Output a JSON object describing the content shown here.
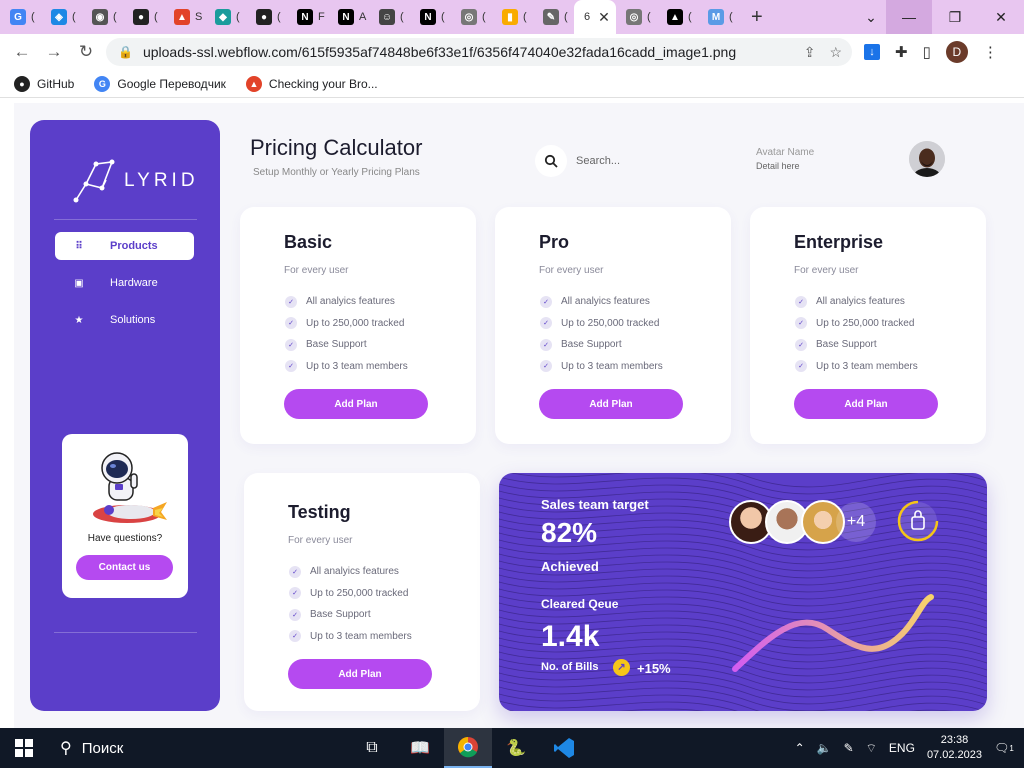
{
  "browser": {
    "tabs": [
      {
        "icon": "google-translate-icon",
        "color": "#4285f4",
        "glyph": "G",
        "label": "("
      },
      {
        "icon": "vscode-blue-icon",
        "color": "#1e88e5",
        "glyph": "◈",
        "label": "("
      },
      {
        "icon": "browser-icon",
        "color": "#555555",
        "glyph": "◉",
        "label": "("
      },
      {
        "icon": "github-icon",
        "color": "#222222",
        "glyph": "●",
        "label": "("
      },
      {
        "icon": "gitlab-icon",
        "color": "#e24329",
        "glyph": "▲",
        "label": "S"
      },
      {
        "icon": "diamond-icon",
        "color": "#1a9c9c",
        "glyph": "◆",
        "label": "("
      },
      {
        "icon": "github-icon",
        "color": "#222222",
        "glyph": "●",
        "label": "("
      },
      {
        "icon": "nextjs-icon",
        "color": "#000000",
        "glyph": "N",
        "label": "F"
      },
      {
        "icon": "nextjs-icon",
        "color": "#000000",
        "glyph": "N",
        "label": "A"
      },
      {
        "icon": "face-icon",
        "color": "#444444",
        "glyph": "☺",
        "label": "("
      },
      {
        "icon": "nextjs-icon",
        "color": "#000000",
        "glyph": "N",
        "label": "("
      },
      {
        "icon": "chrome-icon",
        "color": "#777777",
        "glyph": "◎",
        "label": "("
      },
      {
        "icon": "analytics-icon",
        "color": "#f9ab00",
        "glyph": "▮",
        "label": "("
      },
      {
        "icon": "pen-icon",
        "color": "#666666",
        "glyph": "✎",
        "label": "("
      }
    ],
    "active_tab": {
      "label": "6",
      "close": "✕"
    },
    "tabs_after": [
      {
        "icon": "chrome-icon",
        "color": "#777777",
        "glyph": "◎",
        "label": "("
      },
      {
        "icon": "vercel-icon",
        "color": "#000000",
        "glyph": "▲",
        "label": "("
      },
      {
        "icon": "vs-icon",
        "color": "#5a9be6",
        "glyph": "M",
        "label": "("
      }
    ],
    "new_tab": "+",
    "url": "uploads-ssl.webflow.com/615f5935af74848be6f33e1f/6356f474040e32fada16cadd_image1.png",
    "profile_initial": "D",
    "bookmarks": [
      {
        "label": "GitHub",
        "icon": "github-icon",
        "color": "#222222",
        "glyph": "●"
      },
      {
        "label": "Google Переводчик",
        "icon": "google-translate-icon",
        "color": "#4285f4",
        "glyph": "G"
      },
      {
        "label": "Checking your Bro...",
        "icon": "gitlab-icon",
        "color": "#e24329",
        "glyph": "▲"
      }
    ]
  },
  "sidebar": {
    "logo_text": "LYRID",
    "items": [
      {
        "label": "Products",
        "icon": "grid-icon",
        "glyph": "⠿",
        "active": true
      },
      {
        "label": "Hardware",
        "icon": "save-icon",
        "glyph": "▣",
        "active": false
      },
      {
        "label": "Solutions",
        "icon": "star-icon",
        "glyph": "★",
        "active": false
      }
    ],
    "help_text": "Have questions?",
    "contact_label": "Contact us"
  },
  "header": {
    "title": "Pricing Calculator",
    "subtitle": "Setup Monthly or Yearly Pricing Plans",
    "search_placeholder": "Search...",
    "avatar_name": "Avatar Name",
    "avatar_detail": "Detail here"
  },
  "plans": [
    {
      "name": "Basic",
      "audience": "For every user",
      "features": [
        "All analyics features",
        "Up to 250,000 tracked",
        "Base Support",
        "Up to 3 team members"
      ],
      "button": "Add Plan"
    },
    {
      "name": "Pro",
      "audience": "For every user",
      "features": [
        "All analyics features",
        "Up to 250,000 tracked",
        "Base Support",
        "Up to 3 team members"
      ],
      "button": "Add Plan"
    },
    {
      "name": "Enterprise",
      "audience": "For every user",
      "features": [
        "All analyics features",
        "Up to 250,000 tracked",
        "Base Support",
        "Up to 3 team members"
      ],
      "button": "Add Plan"
    },
    {
      "name": "Testing",
      "audience": "For every user",
      "features": [
        "All analyics features",
        "Up to 250,000 tracked",
        "Base Support",
        "Up to 3 team members"
      ],
      "button": "Add Plan"
    }
  ],
  "stats": {
    "target_label": "Sales team target",
    "target_value": "82%",
    "achieved_label": "Achieved",
    "queue_label": "Cleared Qeue",
    "queue_value": "1.4k",
    "bills_label": "No. of Bills",
    "bills_change": "+15%",
    "more_members": "+4"
  },
  "taskbar": {
    "search_label": "Поиск",
    "lang": "ENG",
    "time": "23:38",
    "date": "07.02.2023",
    "notif_count": "1"
  },
  "colors": {
    "primary": "#5b3ec9",
    "accent": "#b54af0",
    "yellow": "#f5c518"
  }
}
